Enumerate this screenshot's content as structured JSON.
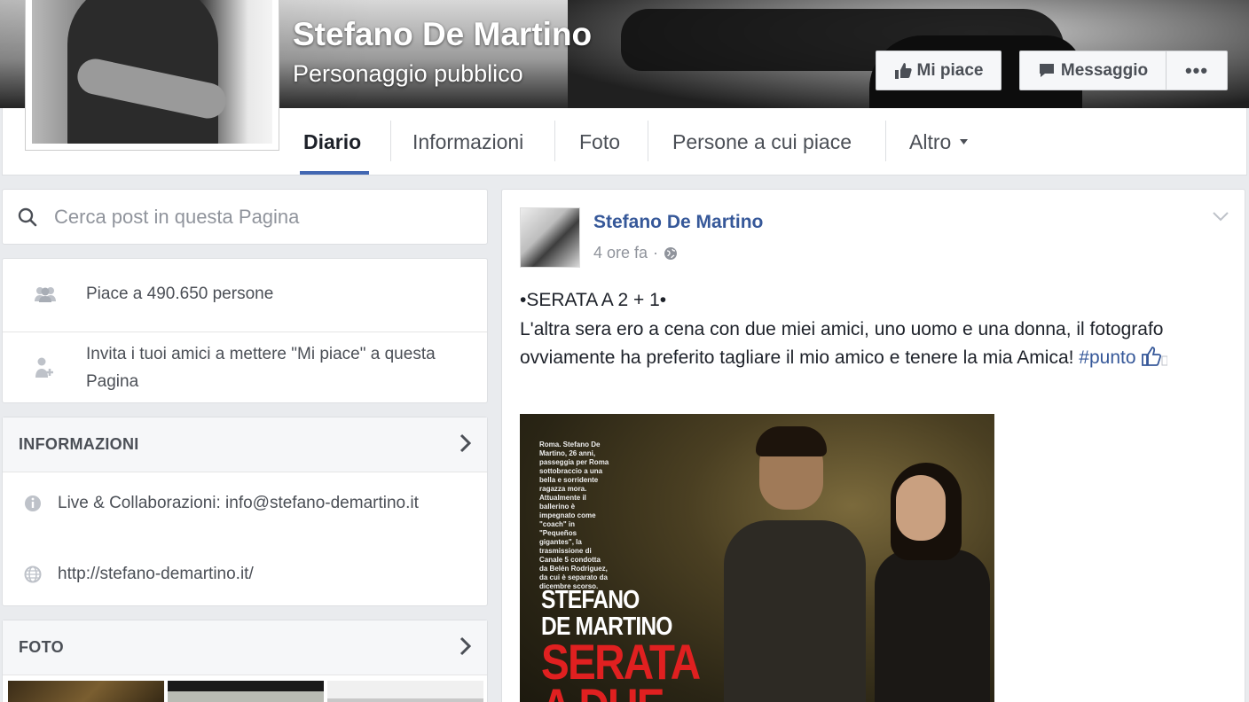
{
  "header": {
    "page_name": "Stefano De Martino",
    "category": "Personaggio pubblico",
    "like_button": "Mi piace",
    "message_button": "Messaggio",
    "more_button": "•••"
  },
  "tabs": [
    {
      "label": "Diario",
      "active": true
    },
    {
      "label": "Informazioni"
    },
    {
      "label": "Foto"
    },
    {
      "label": "Persone a cui piace"
    },
    {
      "label": "Altro"
    }
  ],
  "sidebar": {
    "search_placeholder": "Cerca post in questa Pagina",
    "likes_count_text": "Piace a 490.650 persone",
    "invite_text": "Invita i tuoi amici a mettere \"Mi piace\" a questa Pagina",
    "info": {
      "title": "INFORMAZIONI",
      "contact": "Live & Collaborazioni: info@stefano-demartino.it",
      "website": "http://stefano-demartino.it/"
    },
    "photos": {
      "title": "FOTO"
    }
  },
  "post": {
    "author": "Stefano De Martino",
    "time": "4 ore fa",
    "separator": "·",
    "text_lines": "•SERATA A 2 + 1•\nL'altra sera ero a cena con due miei amici, uno uomo e una donna, il fotografo ovviamente ha preferito tagliare il mio amico e tenere la mia Amica!",
    "hashtag": "#punto",
    "image": {
      "caption_small": "Roma. Stefano De Martino, 26 anni, passeggia per Roma sottobraccio a una bella e sorridente ragazza mora. Attualmente il ballerino è impegnato come \"coach\" in \"Pequeños gigantes\", la trasmissione di Canale 5 condotta da Belén Rodriguez, da cui è separato da dicembre scorso.",
      "name_line1": "STEFANO",
      "name_line2": "DE MARTINO",
      "title_line1": "SERATA",
      "title_line2": "A DUE"
    }
  },
  "colors": {
    "link_blue": "#365899",
    "accent_blue": "#4267b2",
    "page_bg": "#e9ebee"
  }
}
